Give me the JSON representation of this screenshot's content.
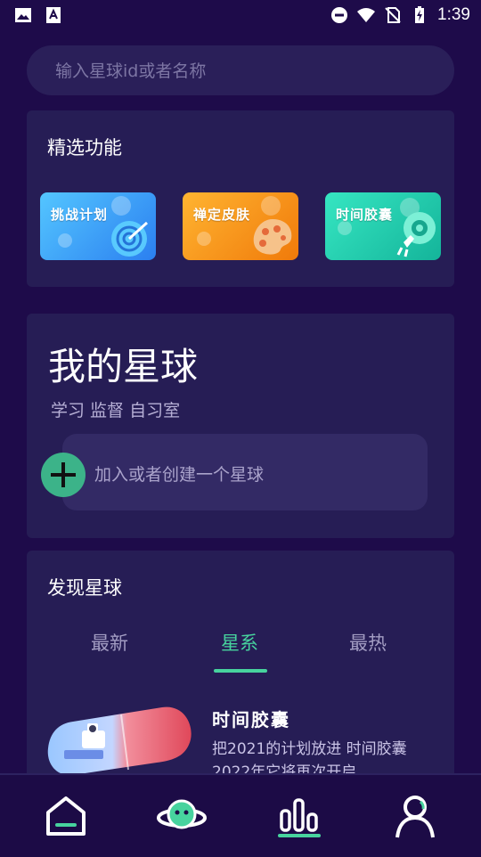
{
  "status_bar": {
    "time": "1:39",
    "left_icons": [
      "image-icon",
      "font-icon"
    ],
    "right_icons": [
      "do-not-disturb-icon",
      "wifi-icon",
      "no-sim-icon",
      "battery-charging-icon"
    ]
  },
  "search": {
    "placeholder": "输入星球id或者名称"
  },
  "featured": {
    "title": "精选功能",
    "tiles": [
      {
        "label": "挑战计划",
        "icon": "target-icon",
        "color": "#3ea6ff"
      },
      {
        "label": "禅定皮肤",
        "icon": "palette-icon",
        "color": "#ff9a1c"
      },
      {
        "label": "时间胶囊",
        "icon": "capsule-rocket-icon",
        "color": "#22d0b0"
      }
    ]
  },
  "my_planet": {
    "title": "我的星球",
    "subtitle": "学习 监督 自习室",
    "join_label": "加入或者创建一个星球"
  },
  "discover": {
    "title": "发现星球",
    "tabs": [
      "最新",
      "星系",
      "最热"
    ],
    "active_tab": "星系",
    "item": {
      "title": "时间胶囊",
      "description": "把2021的计划放进 时间胶囊 2022年它将再次开启"
    }
  },
  "bottom_nav": {
    "items": [
      "home-icon",
      "planet-icon",
      "stats-icon",
      "profile-icon"
    ],
    "active": "stats-icon"
  },
  "colors": {
    "background": "#1e0b4a",
    "card": "#261d55",
    "accent": "#47d39e"
  }
}
